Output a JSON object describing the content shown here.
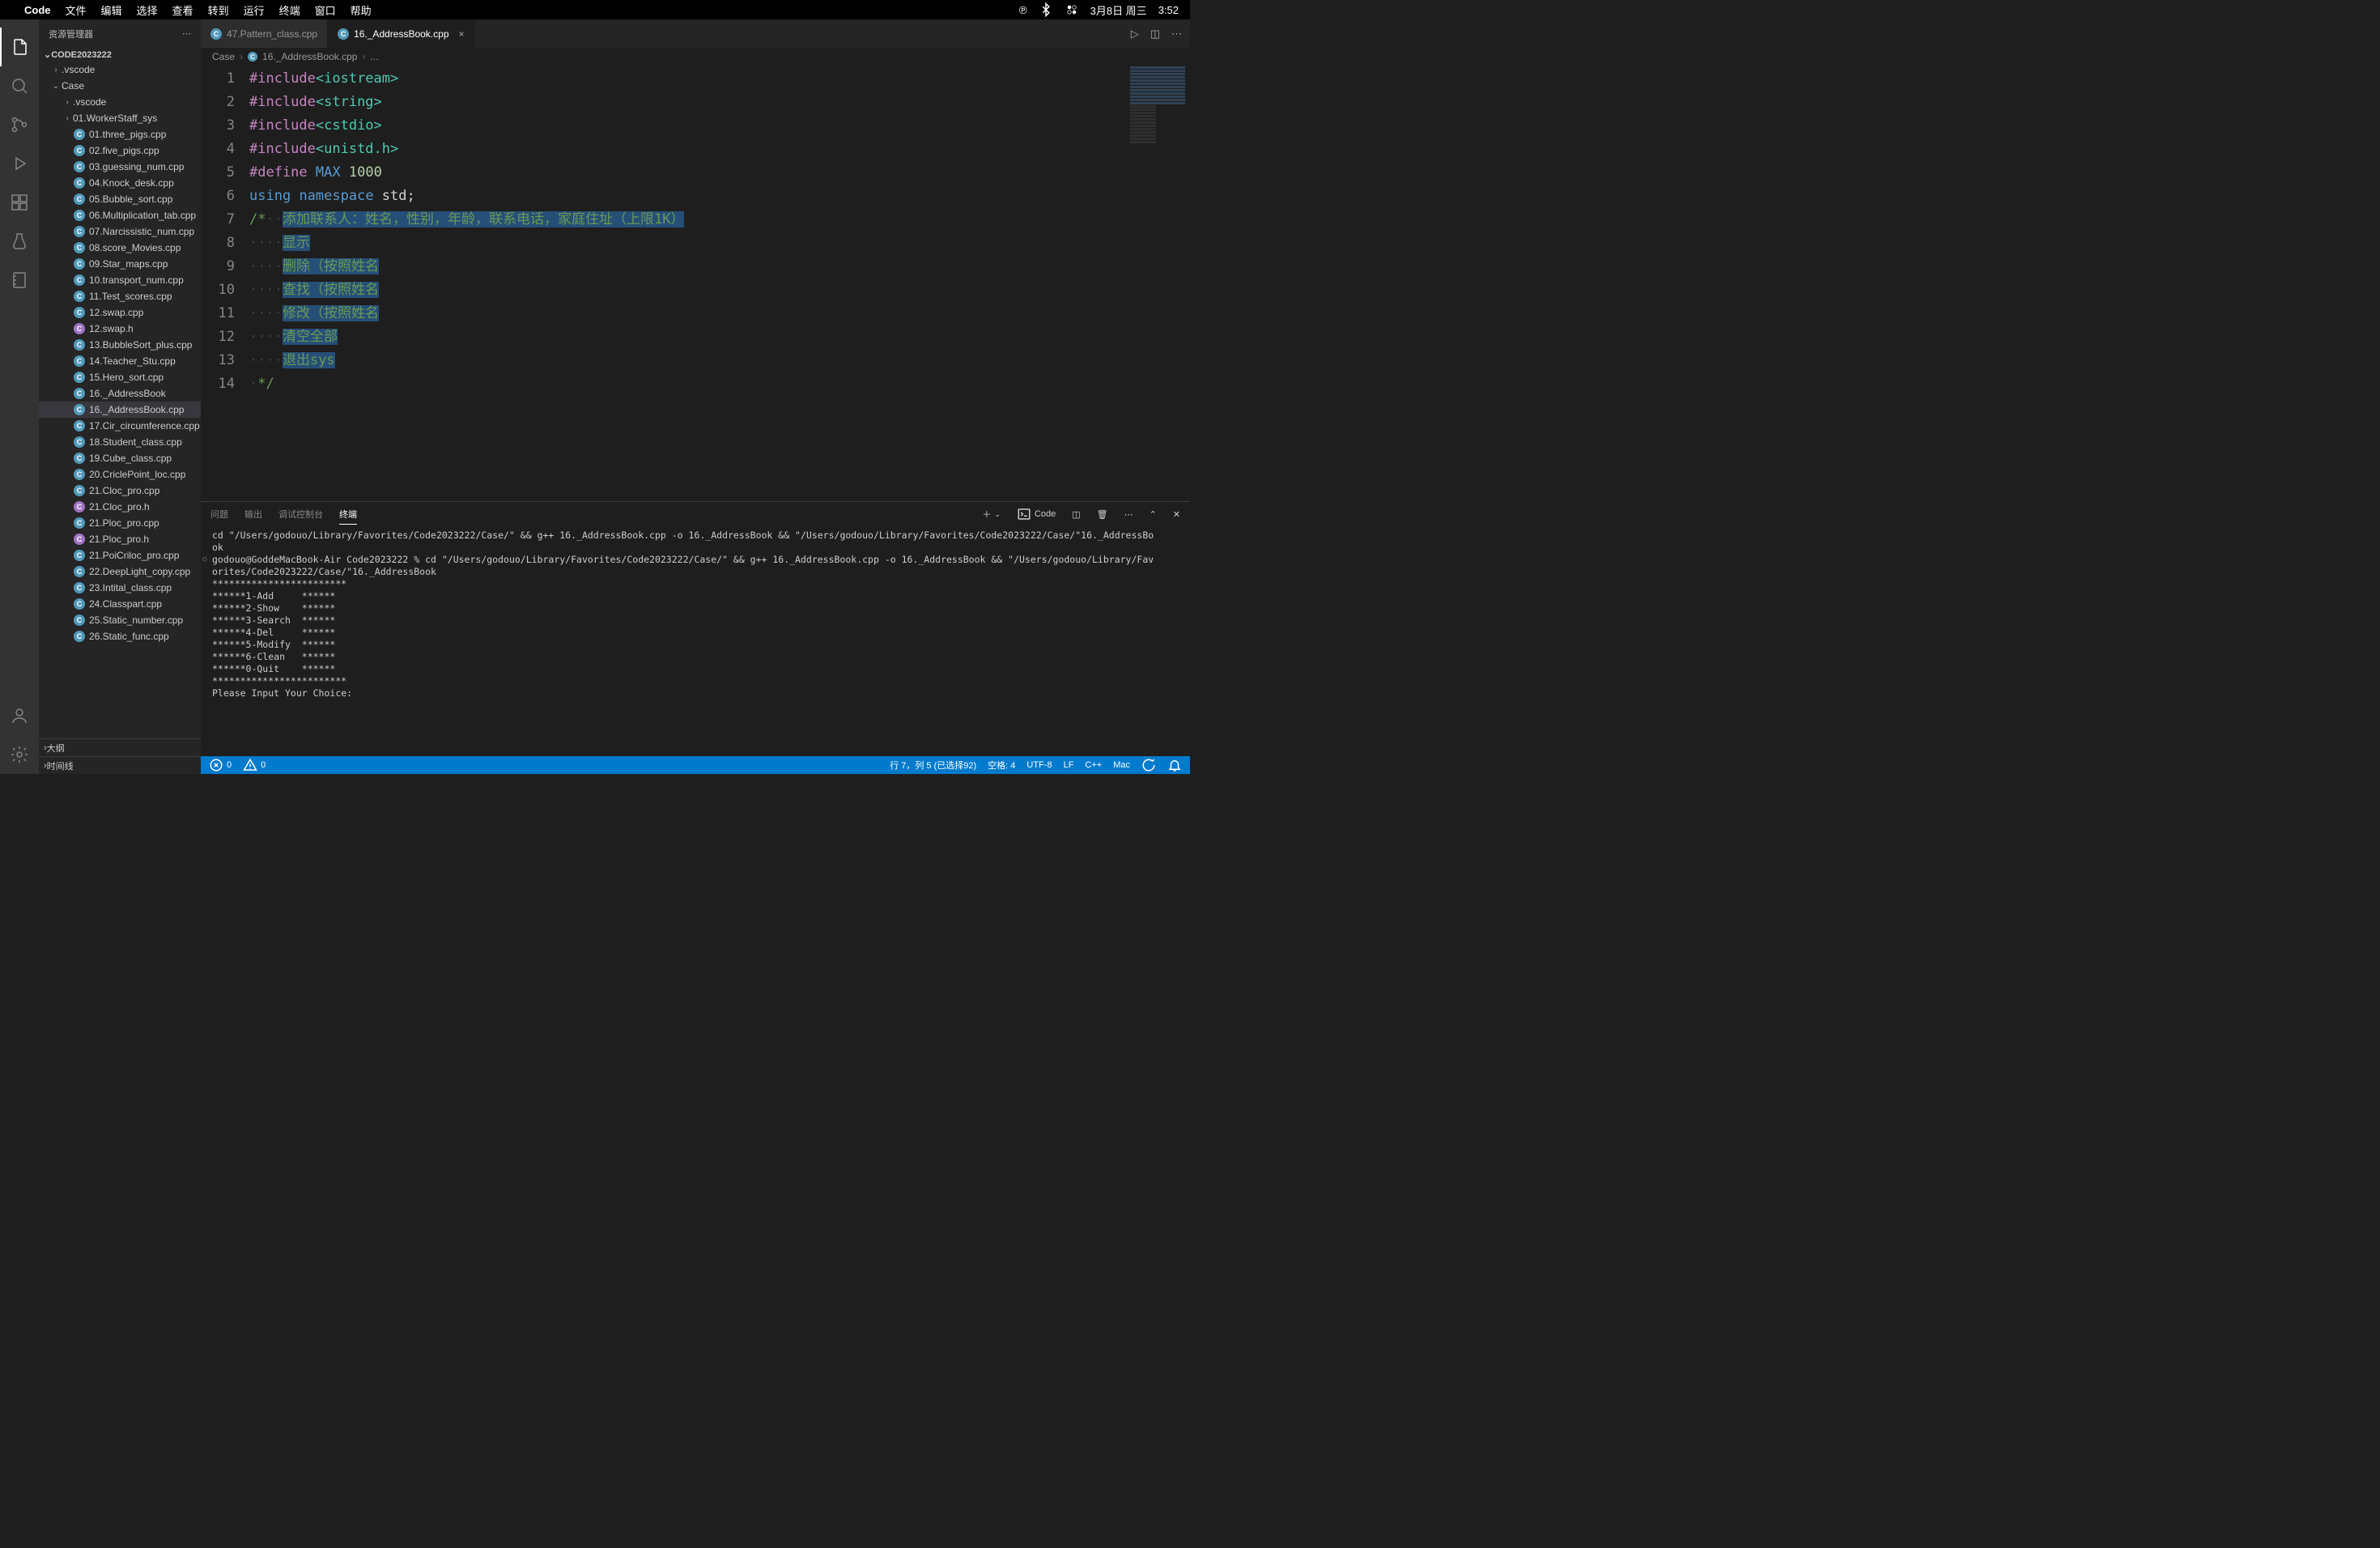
{
  "menubar": {
    "app": "Code",
    "items": [
      "文件",
      "编辑",
      "选择",
      "查看",
      "转到",
      "运行",
      "终端",
      "窗口",
      "帮助"
    ],
    "status": {
      "date": "3月8日 周三",
      "time": "3:52"
    }
  },
  "activity": {
    "items": [
      "files-icon",
      "search-icon",
      "source-control-icon",
      "debug-icon",
      "extensions-icon",
      "testing-icon",
      "bookmark-icon"
    ],
    "bottom": [
      "account-icon",
      "gear-icon"
    ]
  },
  "sidebar": {
    "title": "资源管理器",
    "root": "CODE2023222",
    "folders": [
      {
        "name": ".vscode",
        "depth": 1,
        "open": false
      },
      {
        "name": "Case",
        "depth": 1,
        "open": true
      },
      {
        "name": ".vscode",
        "depth": 2,
        "open": false
      },
      {
        "name": "01.WorkerStaff_sys",
        "depth": 2,
        "open": false
      }
    ],
    "files": [
      "01.three_pigs.cpp",
      "02.five_pigs.cpp",
      "03.guessing_num.cpp",
      "04.Knock_desk.cpp",
      "05.Bubble_sort.cpp",
      "06.Multiplication_tab.cpp",
      "07.Narcissistic_num.cpp",
      "08.score_Movies.cpp",
      "09.Star_maps.cpp",
      "10.transport_num.cpp",
      "11.Test_scores.cpp",
      "12.swap.cpp",
      "12.swap.h",
      "13.BubbleSort_plus.cpp",
      "14.Teacher_Stu.cpp",
      "15.Hero_sort.cpp",
      "16._AddressBook",
      "16._AddressBook.cpp",
      "17.Cir_circumference.cpp",
      "18.Student_class.cpp",
      "19.Cube_class.cpp",
      "20.CriclePoint_loc.cpp",
      "21.Cloc_pro.cpp",
      "21.Cloc_pro.h",
      "21.Ploc_pro.cpp",
      "21.Ploc_pro.h",
      "21.PoiCriloc_pro.cpp",
      "22.DeepLight_copy.cpp",
      "23.Intital_class.cpp",
      "24.Classpart.cpp",
      "25.Static_number.cpp",
      "26.Static_func.cpp"
    ],
    "active_file": "16._AddressBook.cpp",
    "sections": [
      "大纲",
      "时间线"
    ]
  },
  "tabs": {
    "items": [
      {
        "label": "47.Pattern_class.cpp",
        "active": false
      },
      {
        "label": "16._AddressBook.cpp",
        "active": true
      }
    ]
  },
  "breadcrumb": {
    "parts": [
      "Case",
      "16._AddressBook.cpp",
      "..."
    ]
  },
  "code": {
    "lines": [
      {
        "n": 1,
        "html": "<span class='k-keyword'>#include</span><span class='k-string'>&lt;iostream&gt;</span>"
      },
      {
        "n": 2,
        "html": "<span class='k-keyword'>#include</span><span class='k-string'>&lt;string&gt;</span>"
      },
      {
        "n": 3,
        "html": "<span class='k-keyword'>#include</span><span class='k-string'>&lt;cstdio&gt;</span>"
      },
      {
        "n": 4,
        "html": "<span class='k-keyword'>#include</span><span class='k-string'>&lt;unistd.h&gt;</span>"
      },
      {
        "n": 5,
        "html": "<span class='k-keyword'>#define</span> <span class='k-macro'>MAX</span> <span class='k-num'>1000</span>"
      },
      {
        "n": 6,
        "html": "<span class='k-type'>using</span> <span class='k-type'>namespace</span> std;"
      },
      {
        "n": 7,
        "html": "<span class='k-comment'>/*</span><span class='ws'>··</span><span class='sel k-comment'>添加联系人：姓名，性别，年龄，联系电话，家庭住址（上限1K）</span>"
      },
      {
        "n": 8,
        "html": "<span class='ws'>····</span><span class='sel k-comment'>显示</span>"
      },
      {
        "n": 9,
        "html": "<span class='ws'>····</span><span class='sel k-comment'>删除（按照姓名</span>"
      },
      {
        "n": 10,
        "html": "<span class='ws'>····</span><span class='sel k-comment'>查找（按照姓名</span>"
      },
      {
        "n": 11,
        "html": "<span class='ws'>····</span><span class='sel k-comment'>修改（按照姓名</span>"
      },
      {
        "n": 12,
        "html": "<span class='ws'>····</span><span class='sel k-comment'>清空全部</span>"
      },
      {
        "n": 13,
        "html": "<span class='ws'>····</span><span class='sel k-comment'>退出sys</span>"
      },
      {
        "n": 14,
        "html": "<span class='ws'>·</span><span class='k-comment'>*/</span>"
      }
    ]
  },
  "panel": {
    "tabs": [
      "问题",
      "输出",
      "调试控制台",
      "终端"
    ],
    "active_tab": "终端",
    "shell_label": "Code",
    "terminal_lines": [
      "cd \"/Users/godouo/Library/Favorites/Code2023222/Case/\" && g++ 16._AddressBook.cpp -o 16._AddressBook && \"/Users/godouo/Library/Favorites/Code2023222/Case/\"16._AddressBo",
      "ok",
      "godouo@GoddeMacBook-Air Code2023222 % cd \"/Users/godouo/Library/Favorites/Code2023222/Case/\" && g++ 16._AddressBook.cpp -o 16._AddressBook && \"/Users/godouo/Library/Fav",
      "orites/Code2023222/Case/\"16._AddressBook",
      "************************",
      "******1-Add     ******",
      "******2-Show    ******",
      "******3-Search  ******",
      "******4-Del     ******",
      "******5-Modify  ******",
      "******6-Clean   ******",
      "******0-Quit    ******",
      "************************",
      "Please Input Your Choice:"
    ]
  },
  "statusbar": {
    "errors": "0",
    "warnings": "0",
    "cursor": "行 7，列 5 (已选择92)",
    "spaces": "空格: 4",
    "encoding": "UTF-8",
    "eol": "LF",
    "lang": "C++",
    "os": "Mac"
  }
}
